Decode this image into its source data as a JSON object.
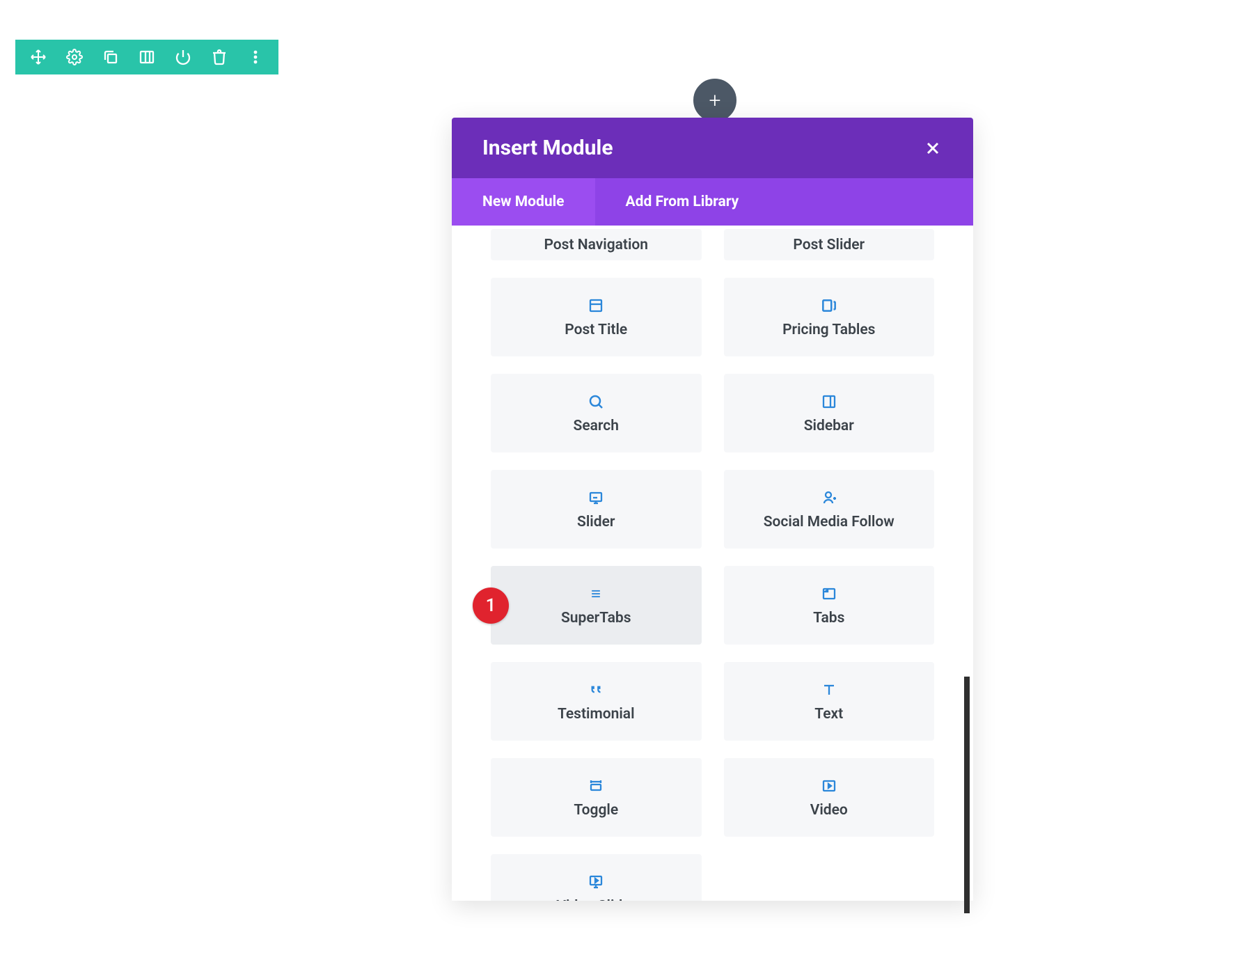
{
  "toolbar": {
    "icons": [
      "move-icon",
      "gear-icon",
      "duplicate-icon",
      "columns-icon",
      "power-icon",
      "trash-icon",
      "more-icon"
    ]
  },
  "add_button": {
    "label": "+"
  },
  "modal": {
    "title": "Insert Module",
    "close_label": "×",
    "tabs": {
      "new_module": "New Module",
      "add_from_library": "Add From Library",
      "active": "new_module"
    }
  },
  "modules": [
    {
      "label": "Post Navigation",
      "icon": "nav-icon",
      "first_row": true
    },
    {
      "label": "Post Slider",
      "icon": "slider-icon",
      "first_row": true
    },
    {
      "label": "Post Title",
      "icon": "window-icon"
    },
    {
      "label": "Pricing Tables",
      "icon": "tables-icon"
    },
    {
      "label": "Search",
      "icon": "search-icon"
    },
    {
      "label": "Sidebar",
      "icon": "sidebar-icon"
    },
    {
      "label": "Slider",
      "icon": "presentation-icon"
    },
    {
      "label": "Social Media Follow",
      "icon": "person-plus-icon"
    },
    {
      "label": "SuperTabs",
      "icon": "menu-icon",
      "hovered": true,
      "annotation": "1"
    },
    {
      "label": "Tabs",
      "icon": "tab-icon"
    },
    {
      "label": "Testimonial",
      "icon": "quote-icon"
    },
    {
      "label": "Text",
      "icon": "text-icon"
    },
    {
      "label": "Toggle",
      "icon": "toggle-icon"
    },
    {
      "label": "Video",
      "icon": "play-icon"
    },
    {
      "label": "Video Slider",
      "icon": "video-slider-icon"
    }
  ]
}
